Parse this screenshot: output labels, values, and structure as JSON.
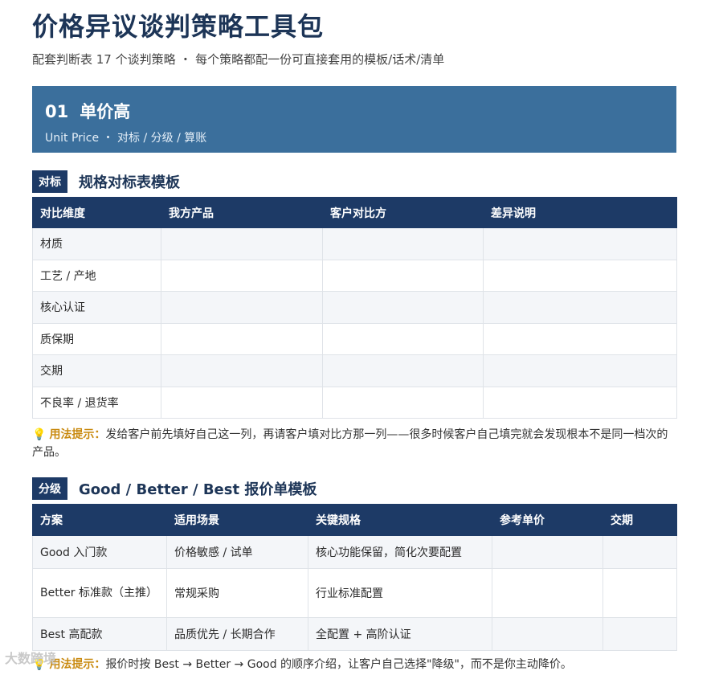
{
  "page": {
    "title": "价格异议谈判策略工具包",
    "subtitle": "配套判断表 17 个谈判策略 ・ 每个策略都配一份可直接套用的模板/话术/清单"
  },
  "strategy": {
    "number": "01",
    "name": "单价高",
    "subtitle": "Unit Price ・ 对标 / 分级 / 算账"
  },
  "section1": {
    "tag": "对标",
    "title": "规格对标表模板",
    "headers": [
      "对比维度",
      "我方产品",
      "客户对比方",
      "差异说明"
    ],
    "rows": [
      [
        "材质",
        "",
        "",
        ""
      ],
      [
        "工艺 / 产地",
        "",
        "",
        ""
      ],
      [
        "核心认证",
        "",
        "",
        ""
      ],
      [
        "质保期",
        "",
        "",
        ""
      ],
      [
        "交期",
        "",
        "",
        ""
      ],
      [
        "不良率 / 退货率",
        "",
        "",
        ""
      ]
    ],
    "tip_label": "用法提示：",
    "tip_text": "发给客户前先填好自己这一列，再请客户填对比方那一列——很多时候客户自己填完就会发现根本不是同一档次的产品。"
  },
  "section2": {
    "tag": "分级",
    "title": "Good / Better / Best 报价单模板",
    "headers": [
      "方案",
      "适用场景",
      "关键规格",
      "参考单价",
      "交期"
    ],
    "rows": [
      [
        "Good 入门款",
        "价格敏感 / 试单",
        "核心功能保留，简化次要配置",
        "",
        ""
      ],
      [
        "Better 标准款（主推）",
        "常规采购",
        "行业标准配置",
        "",
        ""
      ],
      [
        "Best 高配款",
        "品质优先 / 长期合作",
        "全配置 + 高阶认证",
        "",
        ""
      ]
    ],
    "tip_label": "用法提示：",
    "tip_text": "报价时按 Best → Better → Good 的顺序介绍，让客户自己选择\"降级\"，而不是你主动降价。"
  },
  "watermark": "大数跨境",
  "icons": {
    "tip": "lightbulb-icon"
  },
  "colors": {
    "banner": "#3b6f9c",
    "header": "#1d3a66",
    "title": "#1d3557",
    "tip_label": "#c98a10"
  }
}
